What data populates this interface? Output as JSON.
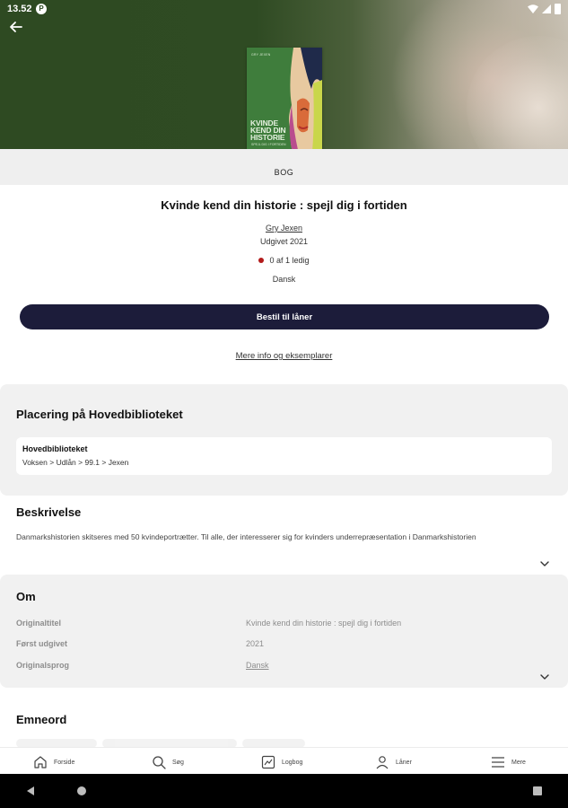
{
  "status_bar": {
    "time": "13.52",
    "app_badge": "P",
    "icons": [
      "wifi-icon",
      "signal-icon",
      "battery-icon"
    ]
  },
  "header": {
    "back_icon": "arrow-left-icon",
    "material_type": "BOG"
  },
  "cover": {
    "author_line": "GRY JEXEN",
    "title_lines": [
      "KVINDE",
      "KEND DIN",
      "HISTORIE"
    ],
    "subtitle_line": "SPEJL DIG I FORTIDEN",
    "background": "#3f7d3c"
  },
  "book": {
    "title": "Kvinde kend din historie : spejl dig i fortiden",
    "author": "Gry Jexen",
    "published": "Udgivet 2021",
    "availability": "0 af 1 ledig",
    "availability_color": "#b31b1b",
    "language": "Dansk"
  },
  "actions": {
    "order_label": "Bestil til låner",
    "more_info_label": "Mere info og eksemplarer",
    "button_color": "#1c1c3a"
  },
  "placement": {
    "heading": "Placering på Hovedbiblioteket",
    "branch": "Hovedbiblioteket",
    "shelf_path": "Voksen > Udlån > 99.1 > Jexen"
  },
  "description": {
    "heading": "Beskrivelse",
    "text": "Danmarkshistorien skitseres med 50 kvindeportrætter. Til alle, der interesserer sig for kvinders underrepræsentation i Danmarkshistorien",
    "expand_icon": "chevron-down-icon"
  },
  "about": {
    "heading": "Om",
    "rows": [
      {
        "label": "Originaltitel",
        "value": "Kvinde kend din historie : spejl dig i fortiden"
      },
      {
        "label": "Først udgivet",
        "value": "2021"
      },
      {
        "label": "Originalsprog",
        "value": "Dansk"
      }
    ],
    "expand_icon": "chevron-down-icon"
  },
  "subjects": {
    "heading": "Emneord"
  },
  "bottom_nav": [
    {
      "label": "Forside",
      "icon": "home-icon"
    },
    {
      "label": "Søg",
      "icon": "search-icon"
    },
    {
      "label": "Logbog",
      "icon": "logbook-icon"
    },
    {
      "label": "Låner",
      "icon": "person-icon"
    },
    {
      "label": "Mere",
      "icon": "menu-icon"
    }
  ],
  "android_nav": [
    "back-triangle-icon",
    "home-circle-icon",
    "recents-square-icon"
  ]
}
